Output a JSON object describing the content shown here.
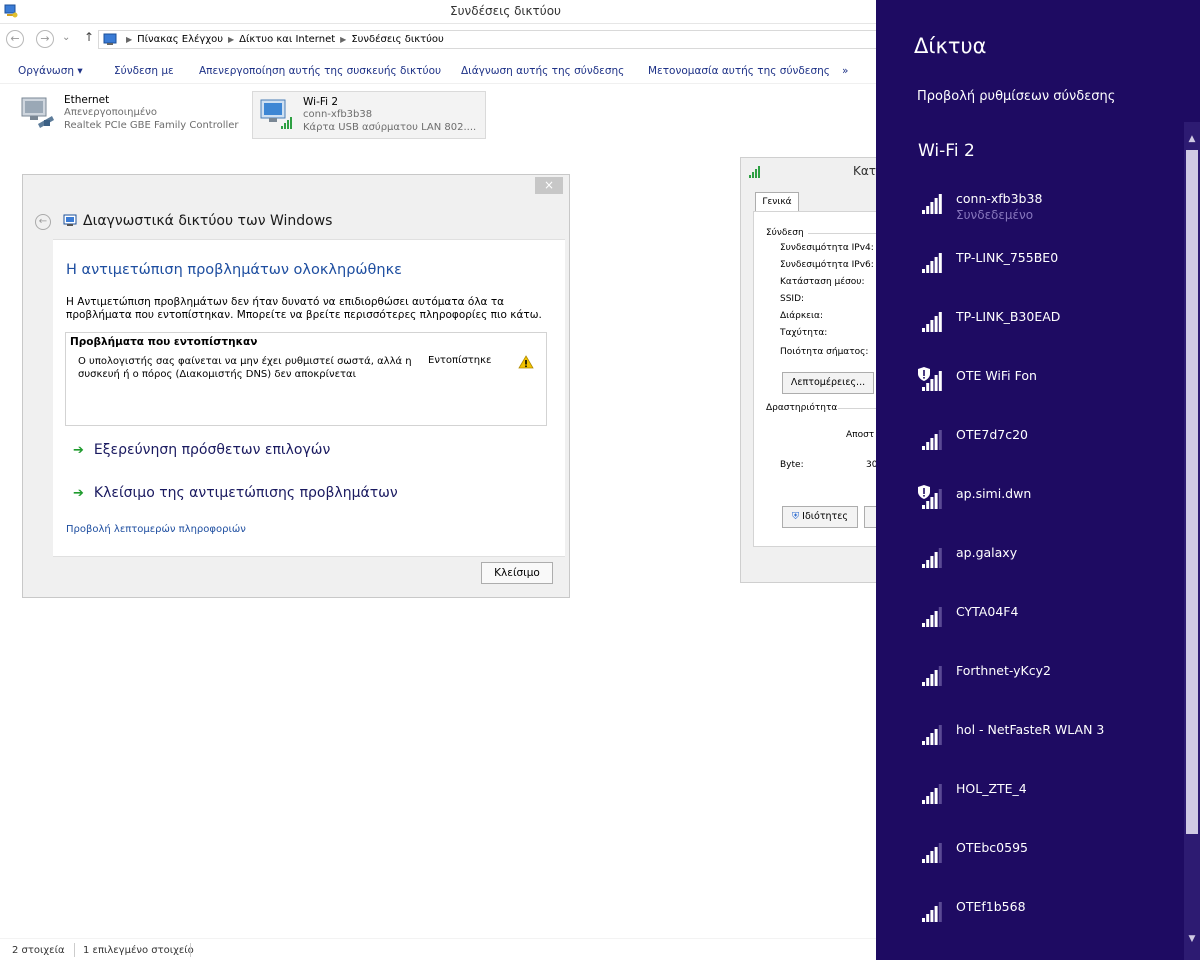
{
  "window": {
    "title": "Συνδέσεις δικτύου"
  },
  "address": {
    "crumbs": [
      "Πίνακας Ελέγχου",
      "Δίκτυο και Internet",
      "Συνδέσεις δικτύου"
    ]
  },
  "commands": {
    "organize": "Οργάνωση ▾",
    "connect": "Σύνδεση με",
    "disable": "Απενεργοποίηση αυτής της συσκευής δικτύου",
    "diagnose": "Διάγνωση αυτής της σύνδεσης",
    "rename": "Μετονομασία αυτής της σύνδεσης",
    "more": "»"
  },
  "items": [
    {
      "name": "Ethernet",
      "line1": "Απενεργοποιημένο",
      "line2": "Realtek PCIe GBE Family Controller"
    },
    {
      "name": "Wi-Fi 2",
      "line1": "conn-xfb3b38",
      "line2": "Κάρτα USB ασύρματου LAN 802...."
    }
  ],
  "statusbar": {
    "count": "2 στοιχεία",
    "selected": "1 επιλεγμένο στοιχείο"
  },
  "diagnostics": {
    "close_x": "×",
    "title": "Διαγνωστικά δικτύου των Windows",
    "heading": "Η αντιμετώπιση προβλημάτων ολοκληρώθηκε",
    "description": "Η Αντιμετώπιση προβλημάτων δεν ήταν δυνατό να επιδιορθώσει αυτόματα όλα τα προβλήματα που εντοπίστηκαν. Μπορείτε να βρείτε περισσότερες πληροφορίες πιο κάτω.",
    "problems_header": "Προβλήματα που εντοπίστηκαν",
    "problem_text": "Ο υπολογιστής σας φαίνεται να μην έχει ρυθμιστεί σωστά, αλλά η συσκευή ή ο πόρος (Διακομιστής DNS) δεν αποκρίνεται",
    "problem_status": "Εντοπίστηκε",
    "link_explore": "Εξερεύνηση πρόσθετων επιλογών",
    "link_close": "Κλείσιμο της αντιμετώπισης προβλημάτων",
    "details_link": "Προβολή λεπτομερών πληροφοριών",
    "close_button": "Κλείσιμο"
  },
  "status_dialog": {
    "title": "Κατ",
    "tab": "Γενικά",
    "section_connection": "Σύνδεση",
    "ipv4": "Συνδεσιμότητα IPv4:",
    "ipv6": "Συνδεσιμότητα IPv6:",
    "media": "Κατάσταση μέσου:",
    "ssid": "SSID:",
    "duration": "Διάρκεια:",
    "speed": "Ταχύτητα:",
    "quality": "Ποιότητα σήματος:",
    "details_btn": "Λεπτομέρειες...",
    "section_activity": "Δραστηριότητα",
    "sent": "Αποστ",
    "bytes": "Byte:",
    "bytes_val": "30",
    "properties_btn": "Ιδιότητες"
  },
  "flyout": {
    "title": "Δίκτυα",
    "view_settings": "Προβολή ρυθμίσεων σύνδεσης",
    "group": "Wi-Fi 2",
    "networks": [
      {
        "name": "conn-xfb3b38",
        "status": "Συνδεδεμένο",
        "secured": true,
        "signal": 5
      },
      {
        "name": "TP-LINK_755BE0",
        "secured": true,
        "signal": 5
      },
      {
        "name": "TP-LINK_B30EAD",
        "secured": true,
        "signal": 5
      },
      {
        "name": "OTE WiFi Fon",
        "secured": false,
        "signal": 5
      },
      {
        "name": "OTE7d7c20",
        "secured": true,
        "signal": 4
      },
      {
        "name": "ap.simi.dwn",
        "secured": false,
        "signal": 4
      },
      {
        "name": "ap.galaxy",
        "secured": true,
        "signal": 4
      },
      {
        "name": "CYTA04F4",
        "secured": true,
        "signal": 4
      },
      {
        "name": "Forthnet-yKcy2",
        "secured": true,
        "signal": 4
      },
      {
        "name": "hol - NetFasteR WLAN 3",
        "secured": true,
        "signal": 4
      },
      {
        "name": "HOL_ZTE_4",
        "secured": true,
        "signal": 4
      },
      {
        "name": "OTEbc0595",
        "secured": true,
        "signal": 4
      },
      {
        "name": "OTEf1b568",
        "secured": true,
        "signal": 4
      }
    ]
  }
}
